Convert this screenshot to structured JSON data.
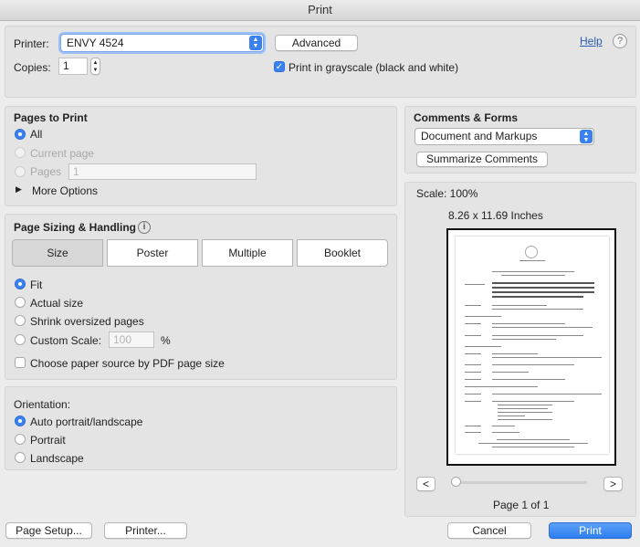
{
  "window": {
    "title": "Print"
  },
  "printer": {
    "label": "Printer:",
    "value": "ENVY 4524",
    "advanced_label": "Advanced",
    "help_label": "Help",
    "help_icon": "question-mark-icon"
  },
  "copies": {
    "label": "Copies:",
    "value": "1"
  },
  "grayscale": {
    "label": "Print in grayscale (black and white)",
    "checked": true
  },
  "pages_to_print": {
    "title": "Pages to Print",
    "all_label": "All",
    "current_label": "Current page",
    "pages_label": "Pages",
    "pages_placeholder": "1",
    "more_options_label": "More Options"
  },
  "sizing": {
    "title": "Page Sizing & Handling",
    "info_icon": "info-icon",
    "tabs": [
      "Size",
      "Poster",
      "Multiple",
      "Booklet"
    ],
    "active_tab": "Size",
    "fit_label": "Fit",
    "actual_label": "Actual size",
    "shrink_label": "Shrink oversized pages",
    "custom_label": "Custom Scale:",
    "custom_placeholder": "100",
    "percent": "%",
    "paper_source_label": "Choose paper source by PDF page size"
  },
  "orientation": {
    "title": "Orientation:",
    "auto_label": "Auto portrait/landscape",
    "portrait_label": "Portrait",
    "landscape_label": "Landscape"
  },
  "comments": {
    "title": "Comments & Forms",
    "select_value": "Document and Markups",
    "summarize_label": "Summarize Comments"
  },
  "preview": {
    "scale": "Scale: 100%",
    "dimensions": "8.26 x 11.69 Inches",
    "prev_label": "<",
    "next_label": ">",
    "page_text": "Page 1 of 1"
  },
  "footer": {
    "page_setup": "Page Setup...",
    "printer": "Printer...",
    "cancel": "Cancel",
    "print": "Print"
  },
  "colors": {
    "accent": "#3b82f0",
    "print_button": "#2f7ef0"
  }
}
